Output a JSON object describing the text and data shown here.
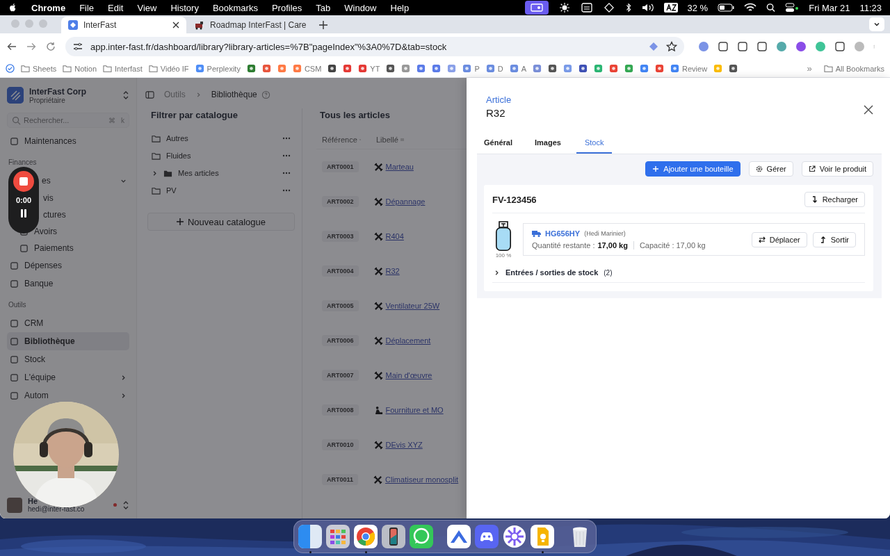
{
  "menubar": {
    "app": "Chrome",
    "menus": [
      "File",
      "Edit",
      "View",
      "History",
      "Bookmarks",
      "Profiles",
      "Tab",
      "Window",
      "Help"
    ],
    "battery": "32 %",
    "date": "Fri Mar 21",
    "time": "11:23"
  },
  "browser": {
    "tabs": [
      {
        "title": "InterFast",
        "selected": true
      },
      {
        "title": "Roadmap InterFast | Care",
        "selected": false
      }
    ],
    "url": "app.inter-fast.fr/dashboard/library?library-articles=%7B\"pageIndex\"%3A0%7D&tab=stock",
    "bookmarks": [
      {
        "kind": "folder",
        "label": "Sheets"
      },
      {
        "kind": "folder",
        "label": "Notion"
      },
      {
        "kind": "folder",
        "label": "Interfast"
      },
      {
        "kind": "folder",
        "label": "Vidéo IF"
      },
      {
        "kind": "site",
        "label": "Perplexity"
      },
      {
        "kind": "site"
      },
      {
        "kind": "site"
      },
      {
        "kind": "site"
      },
      {
        "kind": "site",
        "label": "CSM"
      },
      {
        "kind": "site"
      },
      {
        "kind": "site"
      },
      {
        "kind": "site",
        "label": "YT"
      },
      {
        "kind": "site"
      },
      {
        "kind": "site"
      },
      {
        "kind": "site"
      },
      {
        "kind": "site"
      },
      {
        "kind": "site"
      },
      {
        "kind": "site",
        "label": "P"
      },
      {
        "kind": "site",
        "label": "D"
      },
      {
        "kind": "site",
        "label": "A"
      },
      {
        "kind": "site"
      },
      {
        "kind": "site"
      },
      {
        "kind": "site"
      },
      {
        "kind": "site"
      },
      {
        "kind": "site"
      },
      {
        "kind": "site"
      },
      {
        "kind": "site"
      },
      {
        "kind": "site"
      },
      {
        "kind": "site"
      },
      {
        "kind": "site",
        "label": "Review"
      },
      {
        "kind": "site"
      },
      {
        "kind": "site"
      }
    ],
    "overflow": "»",
    "all_bookmarks": "All Bookmarks"
  },
  "recorder": {
    "time": "0:00"
  },
  "sidebar": {
    "org": "InterFast Corp",
    "role": "Propriétaire",
    "search": {
      "placeholder": "Rechercher...",
      "keys": [
        "⌘",
        "k"
      ]
    },
    "items": [
      {
        "kind": "item",
        "label": "Maintenances",
        "selected": false
      },
      {
        "kind": "section",
        "label": "Finances"
      },
      {
        "kind": "item",
        "label": "es",
        "selected": false,
        "partly_hidden": true,
        "expanded": true,
        "children": [
          {
            "kind": "item",
            "label": "vis",
            "selected": false,
            "partly_hidden": true
          },
          {
            "kind": "item",
            "label": "ctures",
            "selected": false,
            "partly_hidden": true
          },
          {
            "kind": "item",
            "label": "Avoirs",
            "selected": false
          },
          {
            "kind": "item",
            "label": "Paiements",
            "selected": false
          }
        ]
      },
      {
        "kind": "item",
        "label": "Dépenses",
        "selected": false
      },
      {
        "kind": "item",
        "label": "Banque",
        "selected": false
      },
      {
        "kind": "section",
        "label": "Outils"
      },
      {
        "kind": "item",
        "label": "CRM",
        "selected": false
      },
      {
        "kind": "item",
        "label": "Bibliothèque",
        "selected": true
      },
      {
        "kind": "item",
        "label": "Stock",
        "selected": false
      },
      {
        "kind": "item",
        "label": "L'équipe",
        "selected": false,
        "expanded": false
      },
      {
        "kind": "item",
        "label": "Autom",
        "selected": false,
        "expanded": false
      }
    ],
    "user": {
      "name": "He",
      "email": "hedi@inter-fast.co"
    }
  },
  "breadcrumb": [
    "Outils",
    "Bibliothèque"
  ],
  "catalogs": {
    "title": "Filtrer par catalogue",
    "items": [
      {
        "kind": "folder",
        "label": "Autres"
      },
      {
        "kind": "folder",
        "label": "Fluides"
      },
      {
        "kind": "group",
        "label": "Mes articles",
        "expanded": false
      },
      {
        "kind": "folder",
        "label": "PV"
      }
    ],
    "new_button": "Nouveau catalogue"
  },
  "articles": {
    "title": "Tous les articles",
    "columns": [
      "Référence",
      "Libellé"
    ],
    "rows": [
      {
        "ref": "ART0001",
        "label": "Marteau",
        "kind": "tools"
      },
      {
        "ref": "ART0002",
        "label": "Dépannage",
        "kind": "tools"
      },
      {
        "ref": "ART0003",
        "label": "R404",
        "kind": "tools"
      },
      {
        "ref": "ART0004",
        "label": "R32",
        "kind": "tools"
      },
      {
        "ref": "ART0005",
        "label": "Ventilateur 25W",
        "kind": "tools"
      },
      {
        "ref": "ART0006",
        "label": "Déplacement",
        "kind": "tools"
      },
      {
        "ref": "ART0007",
        "label": "Main d'œuvre",
        "kind": "tools"
      },
      {
        "ref": "ART0008",
        "label": "Fourniture et MO",
        "kind": "worker"
      },
      {
        "ref": "ART0010",
        "label": "DEvis XYZ",
        "kind": "tools"
      },
      {
        "ref": "ART0011",
        "label": "Climatiseur monosplit",
        "kind": "tools"
      }
    ]
  },
  "drawer": {
    "eyebrow": "Article",
    "title": "R32",
    "tabs": [
      {
        "label": "Général",
        "selected": false
      },
      {
        "label": "Images",
        "selected": false
      },
      {
        "label": "Stock",
        "selected": true
      }
    ],
    "actions": [
      {
        "label": "Ajouter une bouteille",
        "kind": "primary"
      },
      {
        "label": "Gérer",
        "kind": "settings"
      },
      {
        "label": "Voir le produit",
        "kind": "external"
      }
    ],
    "bottles": [
      {
        "serial": "FV-123456",
        "reload": "Recharger",
        "level": 1,
        "percent": "100 %",
        "vehicle": "HG656HY",
        "holder": "(Hedi Marinier)",
        "remaining_label": "Quantité restante :",
        "remaining": "17,00 kg",
        "capacity": "Capacité : 17,00 kg",
        "move": "Déplacer",
        "exit": "Sortir",
        "history": {
          "label": "Entrées / sorties de stock",
          "count": "(2)",
          "expanded": false
        }
      }
    ]
  }
}
